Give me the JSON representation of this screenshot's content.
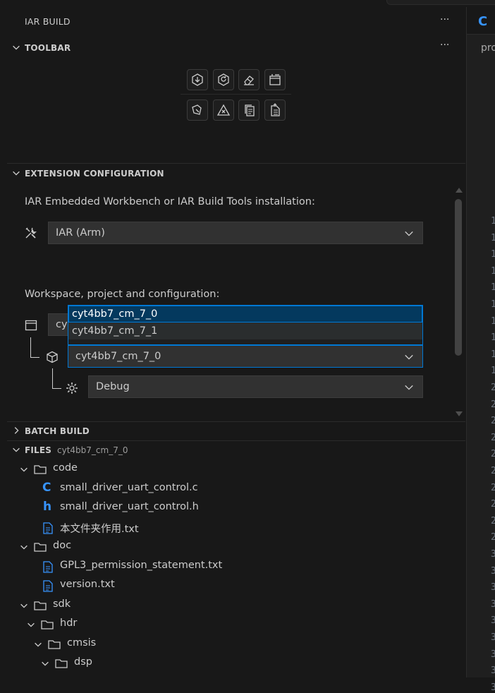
{
  "sidebar": {
    "title": "IAR BUILD",
    "more": "···"
  },
  "toolbar": {
    "title": "TOOLBAR",
    "more": "···",
    "row1": [
      "download-icon",
      "rebuild-icon",
      "clean-icon",
      "open-workbench-icon"
    ],
    "row2": [
      "analyze-icon",
      "stop-icon",
      "copy-config-icon",
      "properties-icon"
    ]
  },
  "config": {
    "title": "EXTENSION CONFIGURATION",
    "install_label": "IAR Embedded Workbench or IAR Build Tools installation:",
    "install_value": "IAR (Arm)",
    "workspace_label": "Workspace, project and configuration:",
    "workspace_value_partial": "cyt",
    "project_value": "cyt4bb7_cm_7_0",
    "project_options": [
      "cyt4bb7_cm_7_0",
      "cyt4bb7_cm_7_1"
    ],
    "configuration_value": "Debug"
  },
  "batch": {
    "title": "BATCH BUILD"
  },
  "files": {
    "title": "FILES",
    "subtitle": "cyt4bb7_cm_7_0",
    "tree": [
      {
        "type": "folder",
        "label": "code",
        "depth": 0
      },
      {
        "type": "c",
        "label": "small_driver_uart_control.c",
        "depth": 1
      },
      {
        "type": "h",
        "label": "small_driver_uart_control.h",
        "depth": 1
      },
      {
        "type": "txt",
        "label": "本文件夹作用.txt",
        "depth": 1
      },
      {
        "type": "folder",
        "label": "doc",
        "depth": 0
      },
      {
        "type": "txt",
        "label": "GPL3_permission_statement.txt",
        "depth": 1
      },
      {
        "type": "txt",
        "label": "version.txt",
        "depth": 1
      },
      {
        "type": "folder",
        "label": "sdk",
        "depth": 0
      },
      {
        "type": "folder",
        "label": "hdr",
        "depth": 1
      },
      {
        "type": "folder",
        "label": "cmsis",
        "depth": 2
      },
      {
        "type": "folder",
        "label": "dsp",
        "depth": 3
      }
    ]
  },
  "editor": {
    "tab_icon": "c-file-icon",
    "breadcrumb": "pro",
    "line_numbers": [
      "1",
      "1",
      "1",
      "1",
      "1",
      "1",
      "1",
      "1",
      "1",
      "1",
      "2",
      "2",
      "2",
      "2",
      "2",
      "2",
      "2",
      "2",
      "2",
      "2",
      "3",
      "3",
      "3",
      "3",
      "3",
      "3",
      "3",
      "3",
      "3"
    ]
  },
  "colors": {
    "background": "#181818",
    "accent": "#0078d4",
    "c_icon": "#3794ff",
    "h_icon": "#3794ff",
    "txt_icon": "#3794ff"
  }
}
